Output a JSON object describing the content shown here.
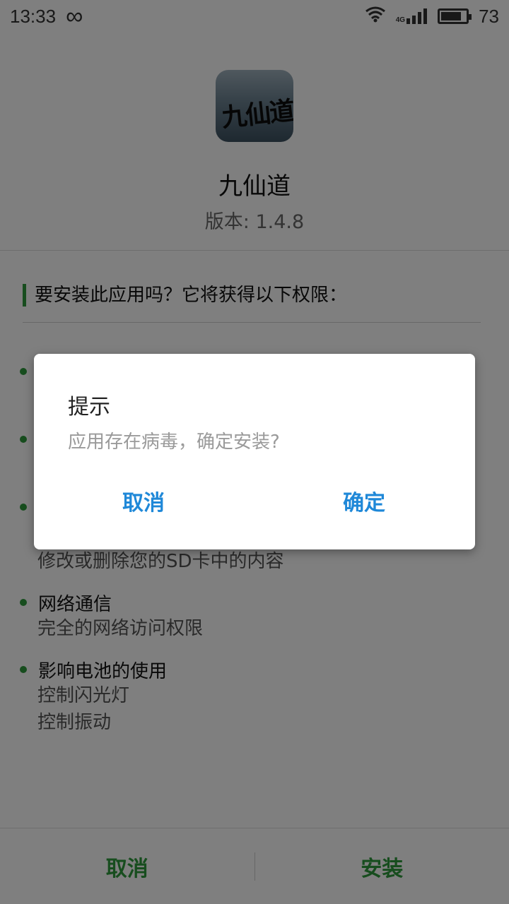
{
  "status_bar": {
    "time": "13:33",
    "network_label": "4G",
    "battery": "73"
  },
  "app": {
    "name": "九仙道",
    "version": "版本: 1.4.8",
    "icon_text": "九仙道"
  },
  "permissions": {
    "heading": "要安装此应用吗？它将获得以下权限：",
    "groups": [
      {
        "title": "",
        "details": []
      },
      {
        "title": "",
        "details": []
      },
      {
        "title": "",
        "details": [
          "修改或删除您的SD卡中的内容"
        ]
      },
      {
        "title": "网络通信",
        "details": [
          "完全的网络访问权限"
        ]
      },
      {
        "title": "影响电池的使用",
        "details": [
          "控制闪光灯",
          "控制振动"
        ]
      }
    ]
  },
  "bottom_bar": {
    "cancel_label": "取消",
    "install_label": "安装"
  },
  "dialog": {
    "title": "提示",
    "message": "应用存在病毒，确定安装?",
    "cancel_label": "取消",
    "ok_label": "确定"
  },
  "colors": {
    "accent_green": "#2e9a3c",
    "dialog_button_blue": "#1f88d8"
  }
}
